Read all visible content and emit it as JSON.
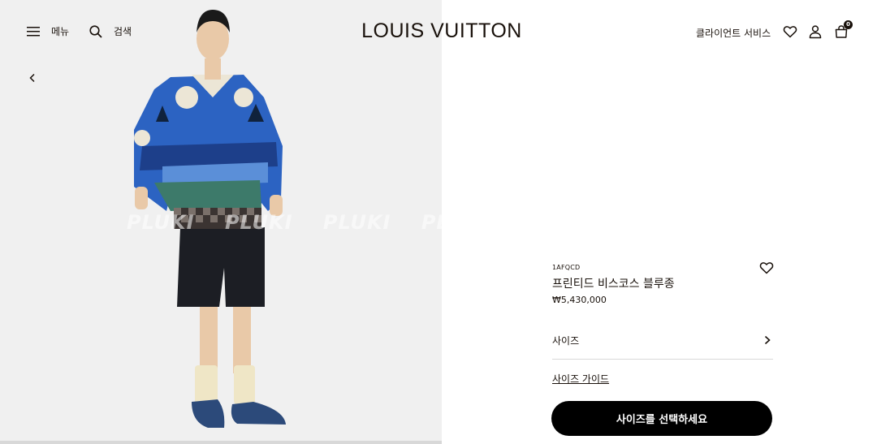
{
  "header": {
    "menu_label": "메뉴",
    "search_label": "검색",
    "logo": "LOUIS VUITTON",
    "client_service": "클라이언트 서비스",
    "cart_count": "0"
  },
  "media": {
    "watermark": "PLUKI PLUKI PLUKI PLUKI PLUKI"
  },
  "product": {
    "sku": "1AFQCD",
    "name": "프린티드 비스코스 블루종",
    "price": "₩5,430,000",
    "size_label": "사이즈",
    "size_guide": "사이즈 가이드",
    "cta_label": "사이즈를 선택하세요"
  },
  "colors": {
    "text": "#19110b",
    "cta_bg": "#000000",
    "image_bg": "#efefef"
  }
}
